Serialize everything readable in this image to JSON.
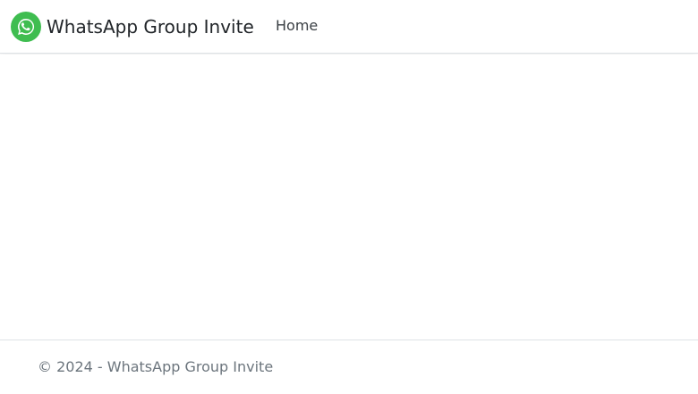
{
  "header": {
    "brand": {
      "icon": "whatsapp-icon",
      "title": "WhatsApp Group Invite"
    },
    "nav": [
      {
        "label": "Home"
      }
    ]
  },
  "footer": {
    "copyright": "© 2024 - WhatsApp Group Invite"
  },
  "colors": {
    "brand_green": "#3fbd50",
    "text": "#212529",
    "muted": "#6c757d",
    "border": "#dee2e6"
  }
}
